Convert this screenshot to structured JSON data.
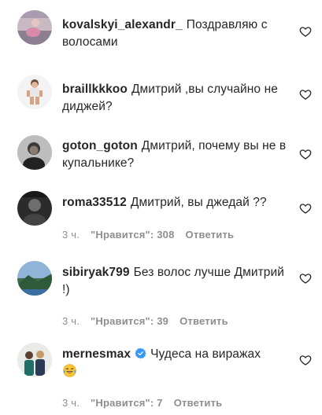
{
  "comments": [
    {
      "username": "kovalskyi_alexandr_",
      "text": "Поздравляю с волосами",
      "avatar": "avatar-kovalskyi"
    },
    {
      "username": "braillkkkoo",
      "text": "Дмитрий ,вы случайно не диджей?",
      "avatar": "avatar-braillkkkoo"
    },
    {
      "username": "goton_goton",
      "text": "Дмитрий, почему вы не в купальнике?",
      "avatar": "avatar-goton"
    },
    {
      "username": "roma33512",
      "text": "Дмитрий, вы джедай ??",
      "time": "3 ч.",
      "likes": "\"Нравится\": 308",
      "reply": "Ответить",
      "avatar": "avatar-roma"
    },
    {
      "username": "sibiryak799",
      "text": "Без волос лучше Дмитрий !)",
      "time": "3 ч.",
      "likes": "\"Нравится\": 39",
      "reply": "Ответить",
      "avatar": "avatar-sibiryak"
    },
    {
      "username": "mernesmax",
      "verified": true,
      "text": "Чудеса на виражах",
      "emoji": "face-with-tears-of-joy",
      "time": "3 ч.",
      "likes": "\"Нравится\": 7",
      "reply": "Ответить",
      "avatar": "avatar-mernesmax"
    }
  ],
  "icons": {
    "like": "heart-outline-icon",
    "verified": "verified-badge-icon"
  },
  "colors": {
    "text": "#262626",
    "meta": "#8e8e8e",
    "verified": "#3897f0"
  }
}
